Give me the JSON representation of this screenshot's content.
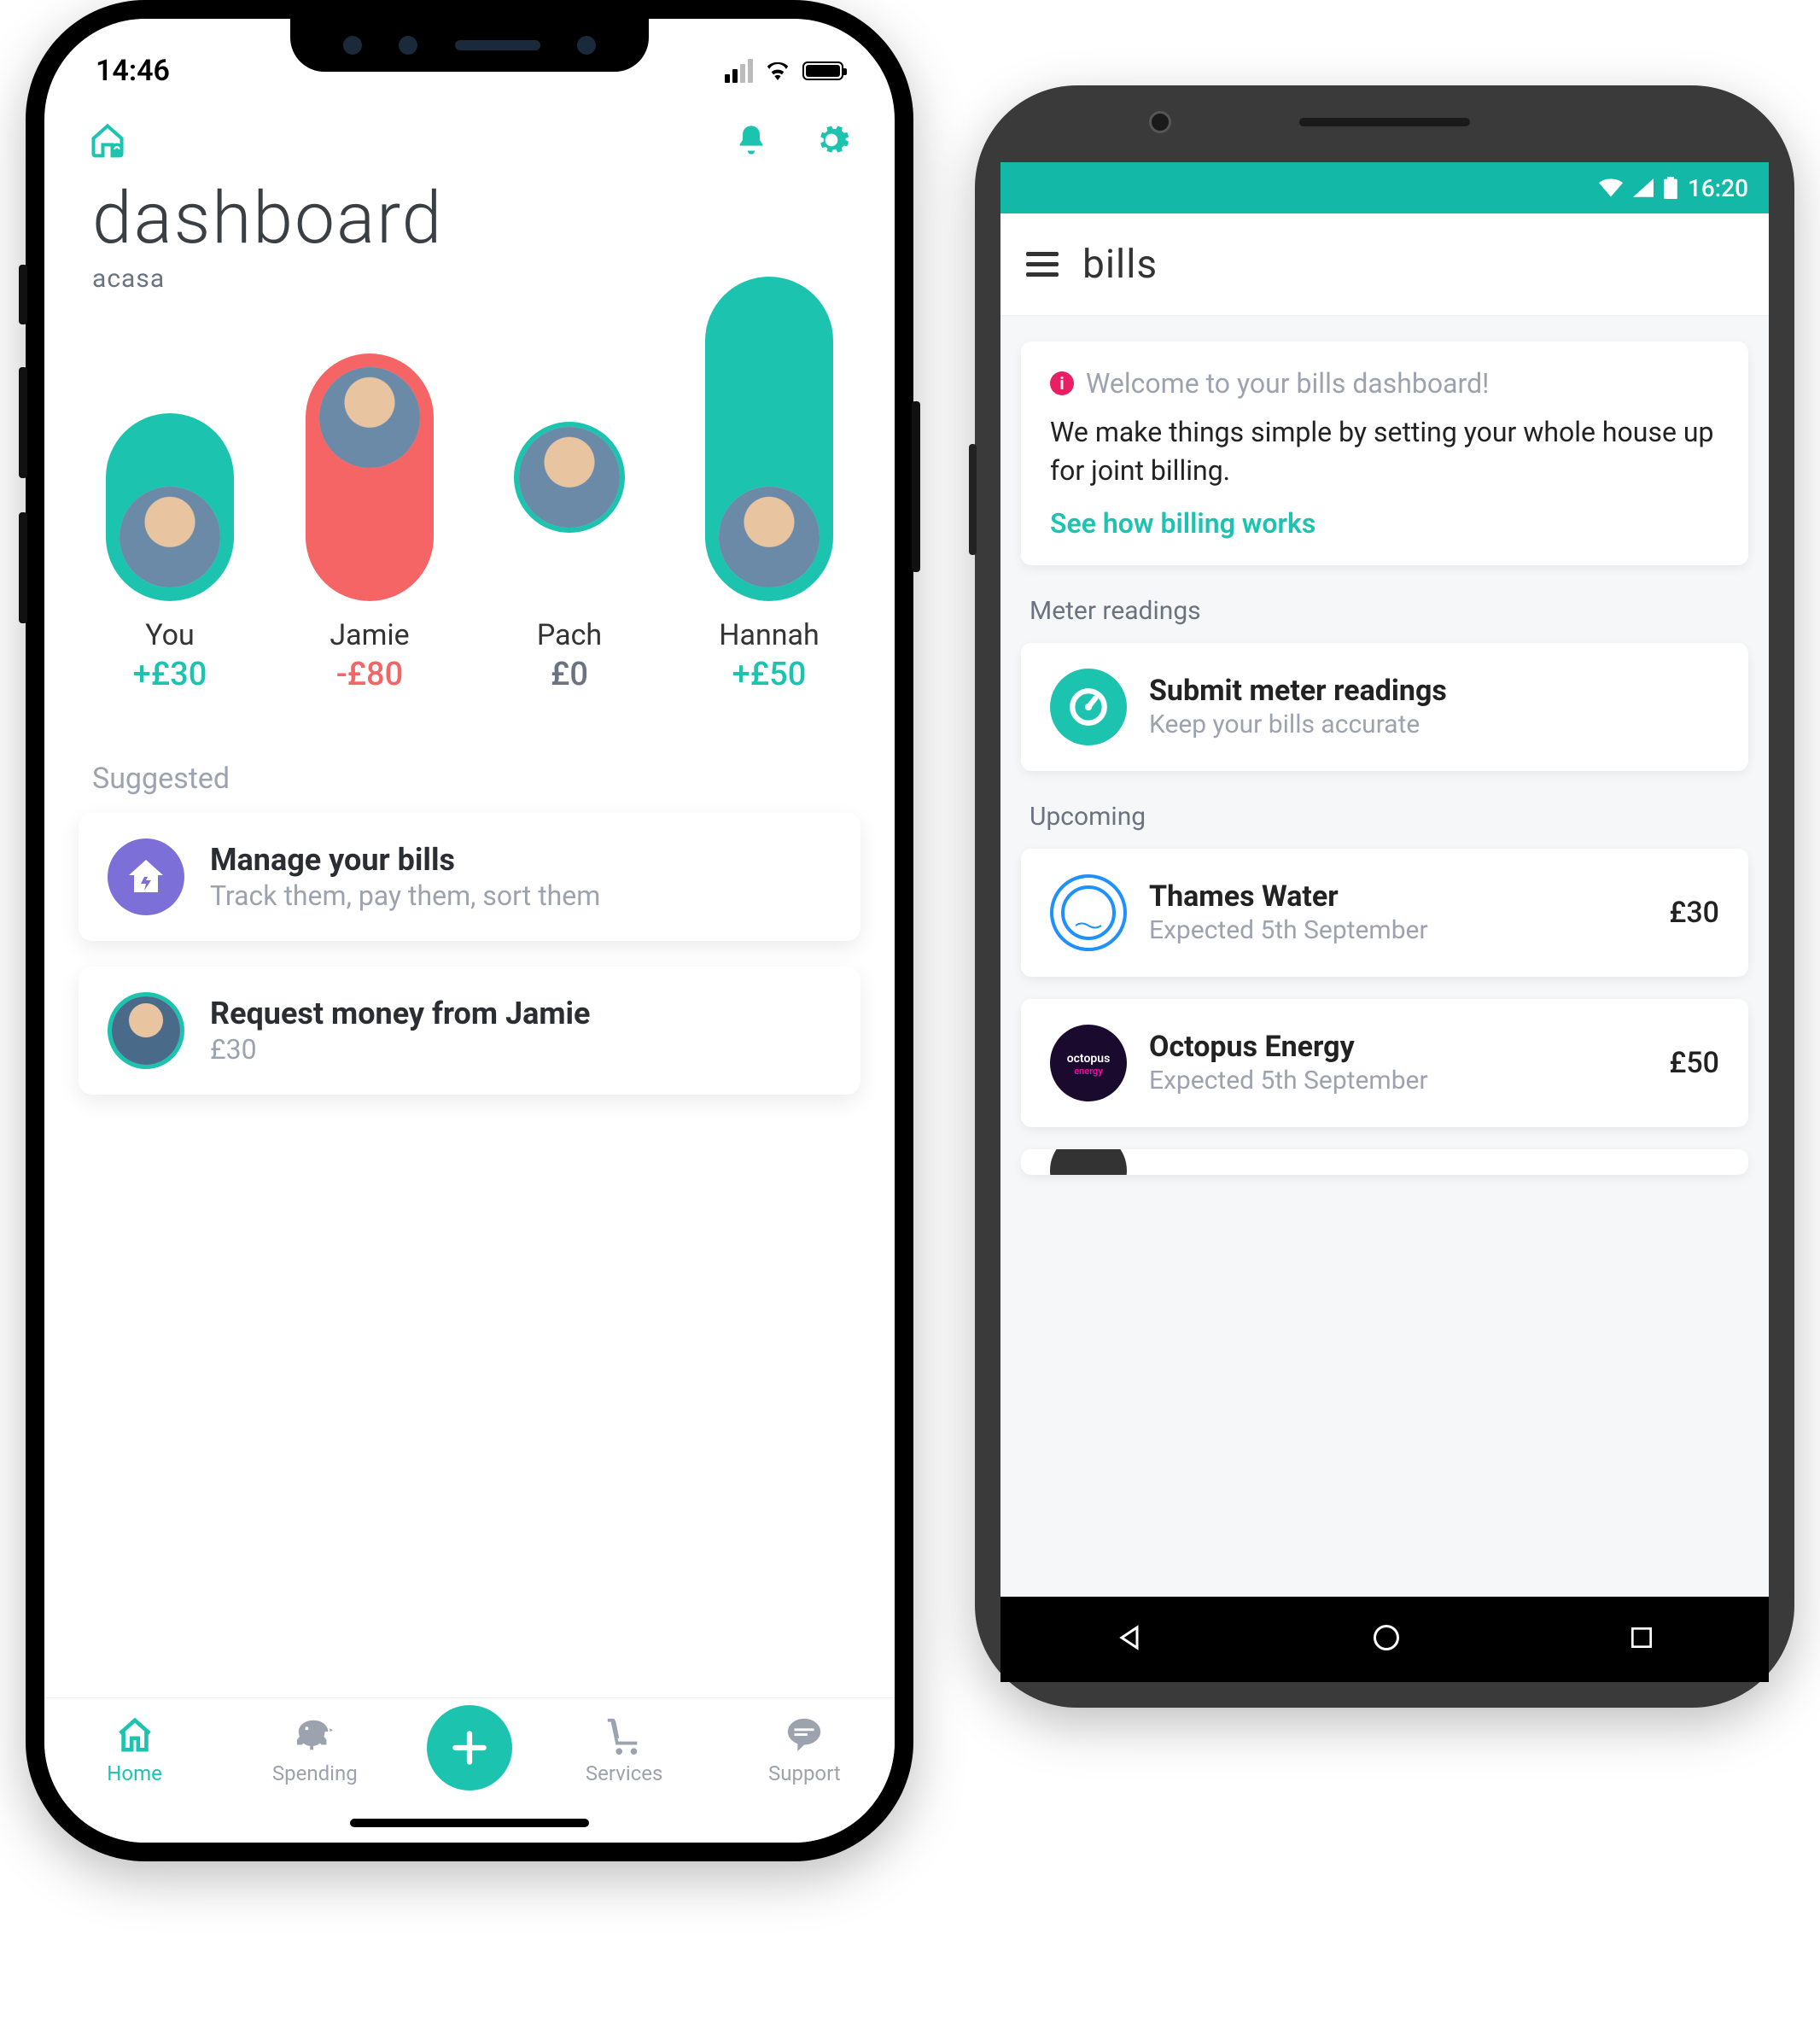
{
  "iphone": {
    "status": {
      "time": "14:46"
    },
    "header": {
      "title": "dashboard",
      "subtitle": "acasa"
    },
    "balances": [
      {
        "name": "You",
        "amount": "+£30",
        "sign": "pos"
      },
      {
        "name": "Jamie",
        "amount": "-£80",
        "sign": "neg"
      },
      {
        "name": "Pach",
        "amount": "£0",
        "sign": "zero"
      },
      {
        "name": "Hannah",
        "amount": "+£50",
        "sign": "pos"
      }
    ],
    "suggested_label": "Suggested",
    "suggested": [
      {
        "title": "Manage your bills",
        "sub": "Track them, pay them, sort them"
      },
      {
        "title": "Request money from Jamie",
        "sub": "£30"
      }
    ],
    "tabs": [
      {
        "label": "Home"
      },
      {
        "label": "Spending"
      },
      {
        "label": ""
      },
      {
        "label": "Services"
      },
      {
        "label": "Support"
      }
    ]
  },
  "android": {
    "status": {
      "time": "16:20"
    },
    "header": {
      "title": "bills"
    },
    "welcome": {
      "title": "Welcome to your bills dashboard!",
      "body": "We make things simple by setting your whole house up for joint billing.",
      "link": "See how billing works"
    },
    "sections": {
      "meter_label": "Meter readings",
      "meter": {
        "title": "Submit meter readings",
        "sub": "Keep your bills accurate"
      },
      "upcoming_label": "Upcoming",
      "upcoming": [
        {
          "name": "Thames Water",
          "sub": "Expected 5th September",
          "amount": "£30",
          "brand": "thames"
        },
        {
          "name": "Octopus Energy",
          "sub": "Expected 5th September",
          "amount": "£50",
          "brand": "octopus"
        }
      ]
    }
  }
}
